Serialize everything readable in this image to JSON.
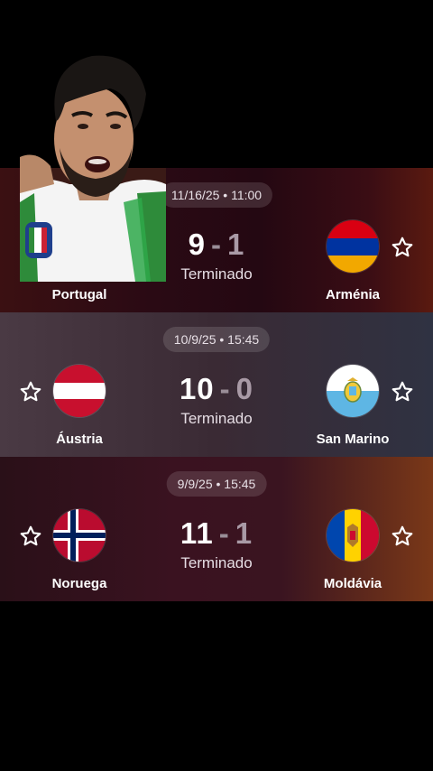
{
  "matches": [
    {
      "datetime": "11/16/25 • 11:00",
      "home": {
        "name": "Portugal",
        "goals": "9"
      },
      "away": {
        "name": "Arménia",
        "goals": "1"
      },
      "separator": "-",
      "status": "Terminado",
      "home_star_visible": false,
      "away_star_visible": true
    },
    {
      "datetime": "10/9/25 • 15:45",
      "home": {
        "name": "Áustria",
        "goals": "10"
      },
      "away": {
        "name": "San Marino",
        "goals": "0"
      },
      "separator": "-",
      "status": "Terminado",
      "home_star_visible": true,
      "away_star_visible": true
    },
    {
      "datetime": "9/9/25 • 15:45",
      "home": {
        "name": "Noruega",
        "goals": "11"
      },
      "away": {
        "name": "Moldávia",
        "goals": "1"
      },
      "separator": "-",
      "status": "Terminado",
      "home_star_visible": true,
      "away_star_visible": true
    }
  ],
  "icons": {
    "favorite": "star-outline-icon"
  },
  "colors": {
    "star": "#ffffff",
    "loser_score": "#a99aa6"
  }
}
